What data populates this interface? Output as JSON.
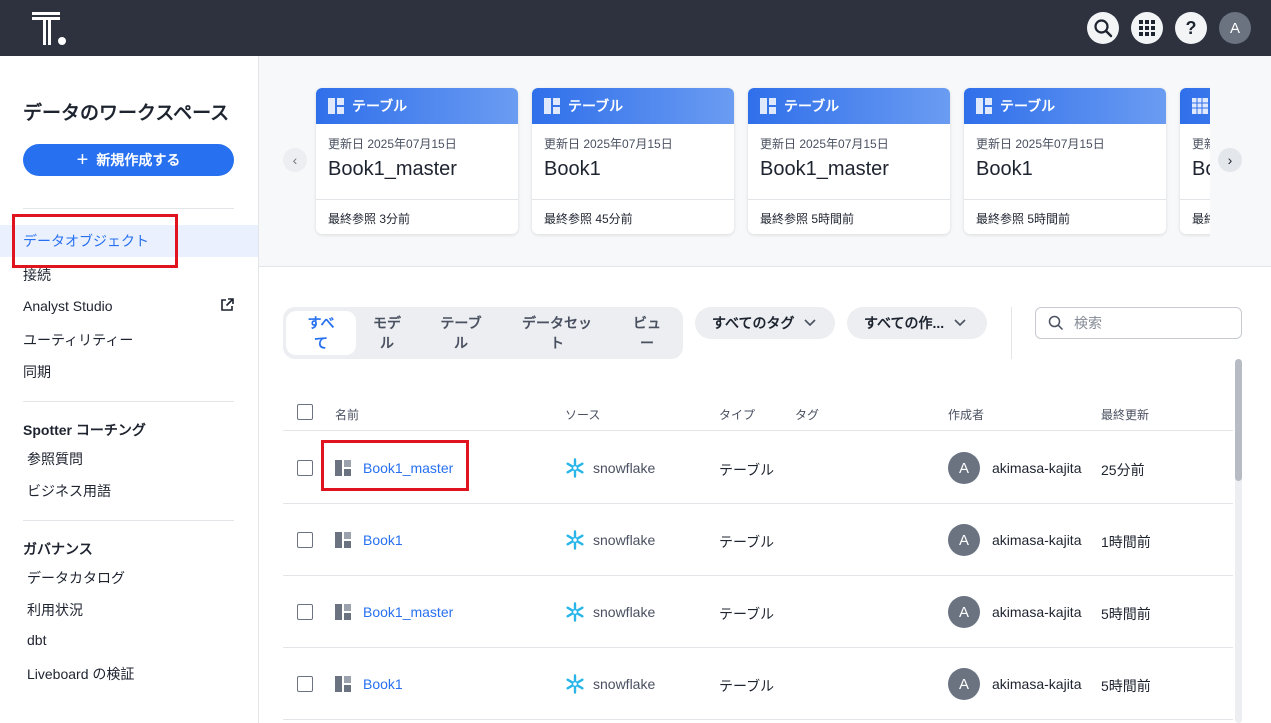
{
  "header": {
    "icons": [
      "search-icon",
      "apps-grid-icon",
      "help-icon"
    ],
    "avatar_initial": "A",
    "help_label": "?"
  },
  "sidebar": {
    "title": "データのワークスペース",
    "new_button": "新規作成する",
    "nav": [
      {
        "label": "データオブジェクト",
        "active": true
      },
      {
        "label": "接続"
      },
      {
        "label": "Analyst Studio",
        "external": true
      },
      {
        "label": "ユーティリティー"
      },
      {
        "label": "同期"
      }
    ],
    "sections": [
      {
        "title": "Spotter コーチング",
        "items": [
          "参照質問",
          "ビジネス用語"
        ]
      },
      {
        "title": "ガバナンス",
        "items": [
          "データカタログ",
          "利用状況",
          "dbt",
          "Liveboard の検証"
        ]
      }
    ]
  },
  "recent_cards": [
    {
      "type": "テーブル",
      "updated": "更新日 2025年07月15日",
      "name": "Book1_master",
      "last_viewed": "最終参照 3分前"
    },
    {
      "type": "テーブル",
      "updated": "更新日 2025年07月15日",
      "name": "Book1",
      "last_viewed": "最終参照 45分前"
    },
    {
      "type": "テーブル",
      "updated": "更新日 2025年07月15日",
      "name": "Book1_master",
      "last_viewed": "最終参照 5時間前"
    },
    {
      "type": "テーブル",
      "updated": "更新日 2025年07月15日",
      "name": "Book1",
      "last_viewed": "最終参照 5時間前"
    },
    {
      "type": "",
      "updated": "更新",
      "name": "Bo",
      "last_viewed": "最終"
    }
  ],
  "filters": {
    "tabs": [
      "すべて",
      "モデル",
      "テーブル",
      "データセット",
      "ビュー"
    ],
    "tabs_display": [
      "すべ\nて",
      "モデ\nル",
      "テーブ\nル",
      "データセッ\nト",
      "ビュ\nー"
    ],
    "tag_dropdown": "すべてのタグ",
    "author_dropdown": "すべての作...",
    "search_placeholder": "検索"
  },
  "table": {
    "columns": [
      "名前",
      "ソース",
      "タイプ",
      "タグ",
      "作成者",
      "最終更新"
    ],
    "rows": [
      {
        "name": "Book1_master",
        "source": "snowflake",
        "type": "テーブル",
        "tag": "",
        "author_initial": "A",
        "author": "akimasa-kajita",
        "updated": "25分前"
      },
      {
        "name": "Book1",
        "source": "snowflake",
        "type": "テーブル",
        "tag": "",
        "author_initial": "A",
        "author": "akimasa-kajita",
        "updated": "1時間前"
      },
      {
        "name": "Book1_master",
        "source": "snowflake",
        "type": "テーブル",
        "tag": "",
        "author_initial": "A",
        "author": "akimasa-kajita",
        "updated": "5時間前"
      },
      {
        "name": "Book1",
        "source": "snowflake",
        "type": "テーブル",
        "tag": "",
        "author_initial": "A",
        "author": "akimasa-kajita",
        "updated": "5時間前"
      }
    ]
  },
  "colors": {
    "accent": "#2770ef",
    "topbar": "#2d323e",
    "highlight": "#e0141e",
    "snowflake": "#29b5e8"
  }
}
